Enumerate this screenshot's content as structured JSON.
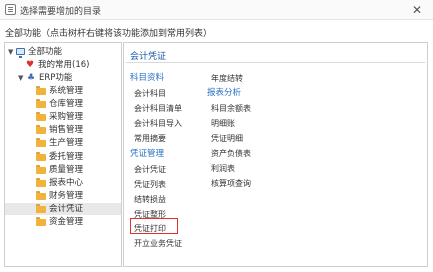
{
  "window": {
    "title": "选择需要增加的目录",
    "close_glyph": "✕"
  },
  "hint": "全部功能（点击树杆右键将该功能添加到常用列表）",
  "tree": {
    "root": "全部功能",
    "favorites": "我的常用(16)",
    "erp": "ERP功能",
    "modules": [
      "系统管理",
      "仓库管理",
      "采购管理",
      "销售管理",
      "生产管理",
      "委托管理",
      "质量管理",
      "报表中心",
      "财务管理",
      "会计凭证",
      "资金管理"
    ],
    "selected_index": 9
  },
  "panel": {
    "title": "会计凭证",
    "col1": [
      {
        "type": "group",
        "label": "科目资料"
      },
      {
        "type": "item",
        "label": "会计科目"
      },
      {
        "type": "item",
        "label": "会计科目清单"
      },
      {
        "type": "item",
        "label": "会计科目导入"
      },
      {
        "type": "item",
        "label": "常用摘要"
      },
      {
        "type": "group",
        "label": "凭证管理"
      },
      {
        "type": "item",
        "label": "会计凭证"
      },
      {
        "type": "item",
        "label": "凭证列表"
      },
      {
        "type": "item",
        "label": "结转损益"
      },
      {
        "type": "item",
        "label": "凭证整形"
      },
      {
        "type": "item",
        "label": "凭证打印"
      },
      {
        "type": "item",
        "label": "开立业务凭证"
      }
    ],
    "col2": [
      {
        "type": "item",
        "label": "年度结转"
      },
      {
        "type": "group",
        "label": "报表分析"
      },
      {
        "type": "item",
        "label": "科目余额表"
      },
      {
        "type": "item",
        "label": "明细账"
      },
      {
        "type": "item",
        "label": "凭证明细"
      },
      {
        "type": "item",
        "label": "资产负债表"
      },
      {
        "type": "item",
        "label": "利润表"
      },
      {
        "type": "item",
        "label": "核算项查询"
      }
    ],
    "highlighted": "凭证打印"
  },
  "colors": {
    "accent_blue": "#1a5aa8",
    "group_blue": "#2a72c4",
    "highlight_red": "#e0312a",
    "folder_orange": "#f0b43c"
  }
}
